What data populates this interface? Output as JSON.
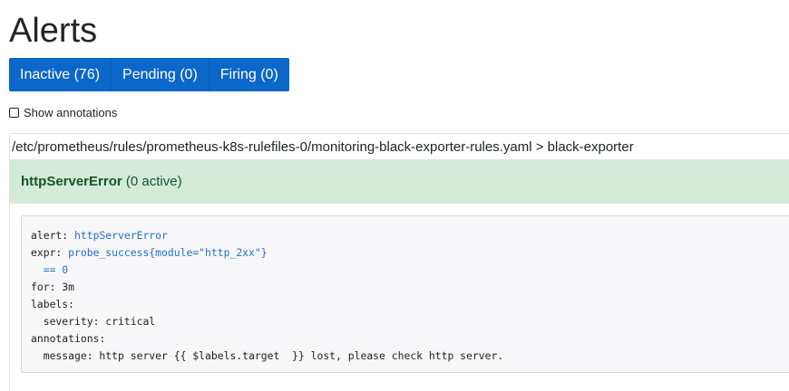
{
  "page": {
    "title": "Alerts"
  },
  "filters": {
    "inactive": "Inactive (76)",
    "pending": "Pending (0)",
    "firing": "Firing (0)"
  },
  "show_annotations": {
    "label": "Show annotations",
    "checked": false
  },
  "group": {
    "path": "/etc/prometheus/rules/prometheus-k8s-rulefiles-0/monitoring-black-exporter-rules.yaml > black-exporter"
  },
  "rule": {
    "name": "httpServerError",
    "active": "(0 active)",
    "header_color": "#d4ebda"
  },
  "code": {
    "alert_key": "alert: ",
    "alert_val": "httpServerError",
    "expr_key": "expr: ",
    "expr_val": "probe_success{module=\"http_2xx\"}",
    "expr_val2": "  == 0",
    "for_line": "for: 3m",
    "labels_line": "labels:",
    "severity_line": "  severity: critical",
    "annotations_line": "annotations:",
    "message_line": "  message: http server {{ $labels.target  }} lost, please check http server."
  },
  "colors": {
    "button": "#0b67c9",
    "accent": "#2170c9"
  }
}
